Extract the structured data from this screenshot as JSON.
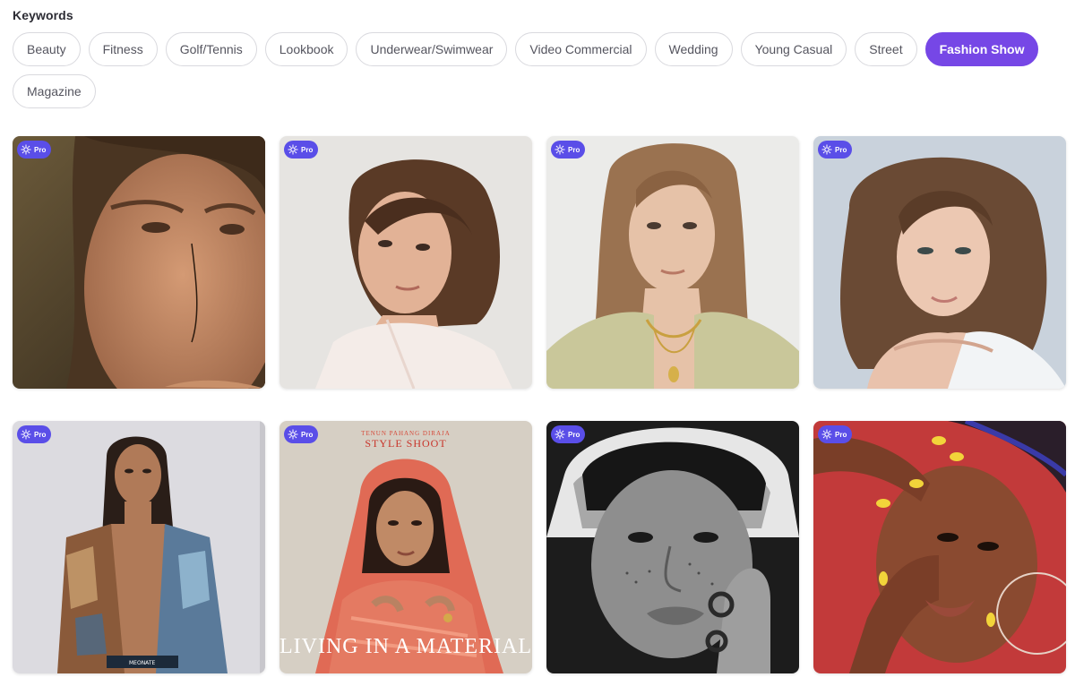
{
  "keywords": {
    "title": "Keywords",
    "chips": [
      {
        "label": "Beauty",
        "active": false
      },
      {
        "label": "Fitness",
        "active": false
      },
      {
        "label": "Golf/Tennis",
        "active": false
      },
      {
        "label": "Lookbook",
        "active": false
      },
      {
        "label": "Underwear/Swimwear",
        "active": false
      },
      {
        "label": "Video Commercial",
        "active": false
      },
      {
        "label": "Wedding",
        "active": false
      },
      {
        "label": "Young Casual",
        "active": false
      },
      {
        "label": "Street",
        "active": false
      },
      {
        "label": "Fashion Show",
        "active": true
      },
      {
        "label": "Magazine",
        "active": false
      }
    ]
  },
  "colors": {
    "accent": "#7647e6",
    "pro_badge": "#5a4ee8"
  },
  "gallery": {
    "badge_label": "Pro",
    "badge_icon": "sparkle-icon",
    "cards": [
      {
        "tag": "Pro"
      },
      {
        "tag": "Pro"
      },
      {
        "tag": "Pro"
      },
      {
        "tag": "Pro"
      },
      {
        "tag": "Pro"
      },
      {
        "tag": "Pro",
        "magazine": {
          "kicker": "TENUN PAHANG DIRAJA",
          "headline": "STYLE SHOOT",
          "cover_line": "LIVING IN A MATERIAL"
        }
      },
      {
        "tag": "Pro"
      },
      {
        "tag": "Pro"
      }
    ]
  }
}
